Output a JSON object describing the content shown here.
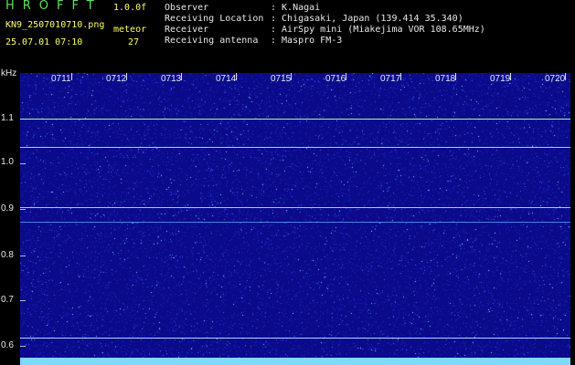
{
  "header": {
    "app_title": "HROFFT",
    "version": "1.0.0f",
    "filename": "KN9_2507010710.png",
    "meteor_label": "meteor",
    "datetime": "25.07.01 07:10",
    "meteor_count": "27"
  },
  "metadata": [
    {
      "label": "Observer",
      "value": ": K.Nagai"
    },
    {
      "label": "Receiving Location",
      "value": ": Chigasaki, Japan (139.414 35.340)"
    },
    {
      "label": "Receiver",
      "value": ": AirSpy mini (Miakejima VOR 108.65MHz)"
    },
    {
      "label": "Receiving antenna",
      "value": ": Maspro FM-3"
    }
  ],
  "axis": {
    "unit": "kHz",
    "y_labels": [
      "1.1",
      "1.0",
      "0.9",
      "0.8",
      "0.7",
      "0.6"
    ],
    "x_labels": [
      "0711",
      "0712",
      "0713",
      "0714",
      "0715",
      "0716",
      "0717",
      "0718",
      "0719",
      "0720"
    ]
  },
  "colors": {
    "background": "#0a0a8a",
    "signal": "#a8ffa8",
    "header_text": "#7dd67d",
    "header_yellow": "#ffff66"
  }
}
